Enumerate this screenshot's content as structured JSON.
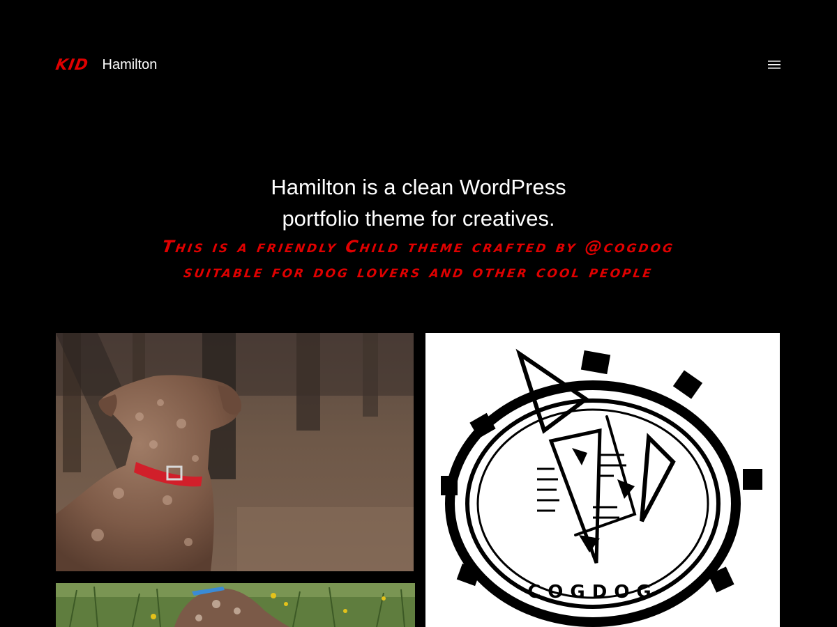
{
  "header": {
    "logo_text": "KID",
    "site_title": "Hamilton",
    "menu_icon": "hamburger-menu-icon"
  },
  "hero": {
    "line1": "Hamilton is a clean WordPress",
    "line2": "portfolio theme for creatives.",
    "child_line1": "This is a friendly Child theme crafted by @cogdog",
    "child_line2": "suitable for dog lovers and other cool people"
  },
  "colors": {
    "background": "#000000",
    "text": "#ffffff",
    "accent": "#e00000"
  },
  "gallery": {
    "items": [
      {
        "image": "dog-in-forest-photo"
      },
      {
        "image": "cogdog-logo-drawing",
        "logo_text": "COGDOG"
      },
      {
        "image": "dog-in-grass-photo"
      }
    ]
  }
}
